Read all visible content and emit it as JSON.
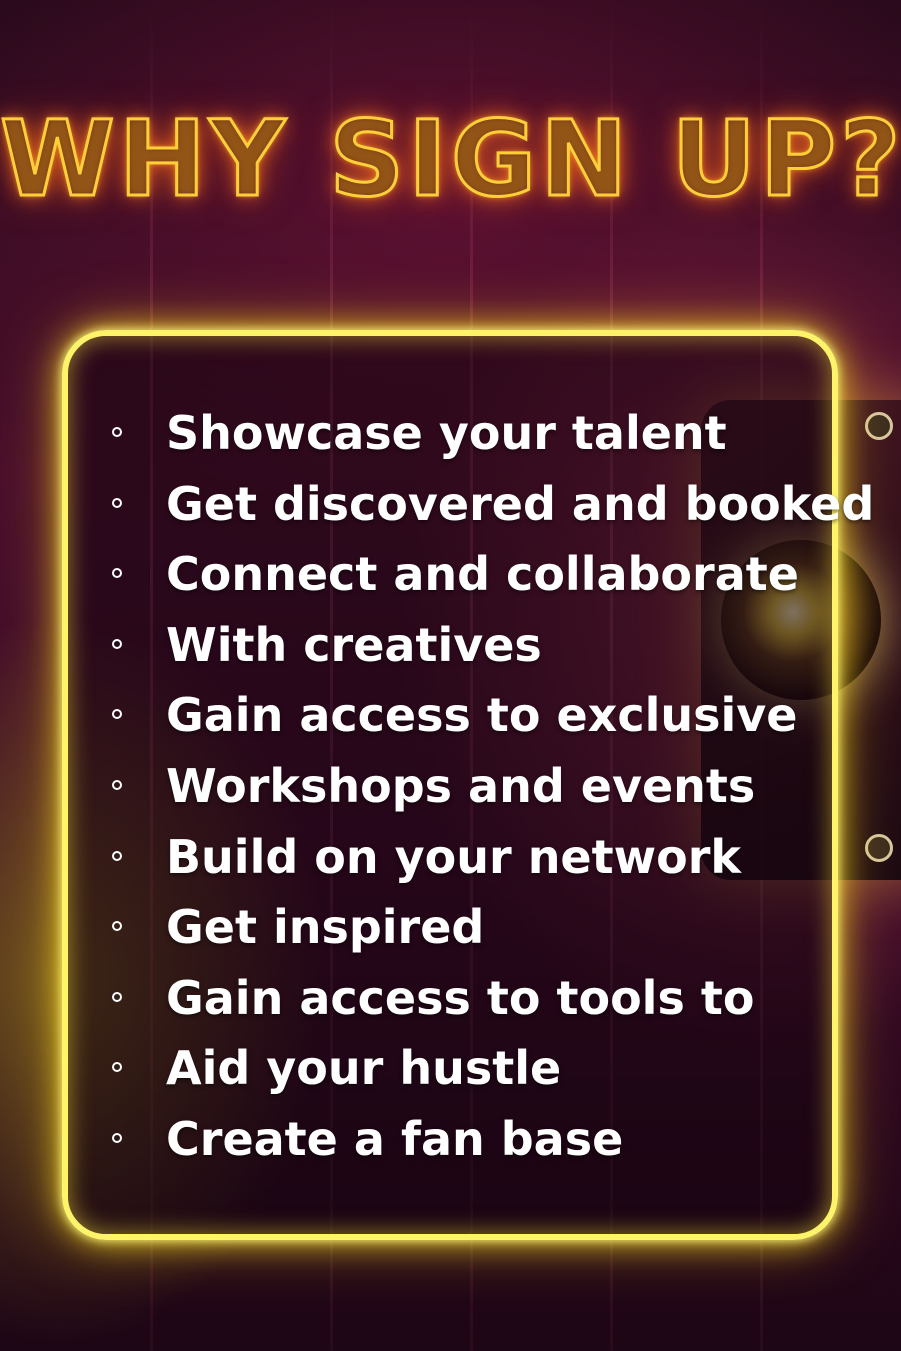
{
  "title": "WHY SIGN UP?",
  "colors": {
    "title_neon": "#ffcf3a",
    "frame_neon": "#fff36a",
    "text": "#ffffff",
    "background": "#4a0f2b"
  },
  "icons": {
    "bullet": "hollow-circle-icon",
    "camera": "camera-icon"
  },
  "list": {
    "items": [
      {
        "label": "Showcase your talent"
      },
      {
        "label": "Get discovered and booked"
      },
      {
        "label": "Connect and collaborate"
      },
      {
        "label": "With creatives"
      },
      {
        "label": "Gain access to exclusive"
      },
      {
        "label": "Workshops and events"
      },
      {
        "label": "Build on your network"
      },
      {
        "label": "Get inspired"
      },
      {
        "label": "Gain access to tools to"
      },
      {
        "label": "Aid your hustle"
      },
      {
        "label": "Create a fan base"
      }
    ]
  }
}
